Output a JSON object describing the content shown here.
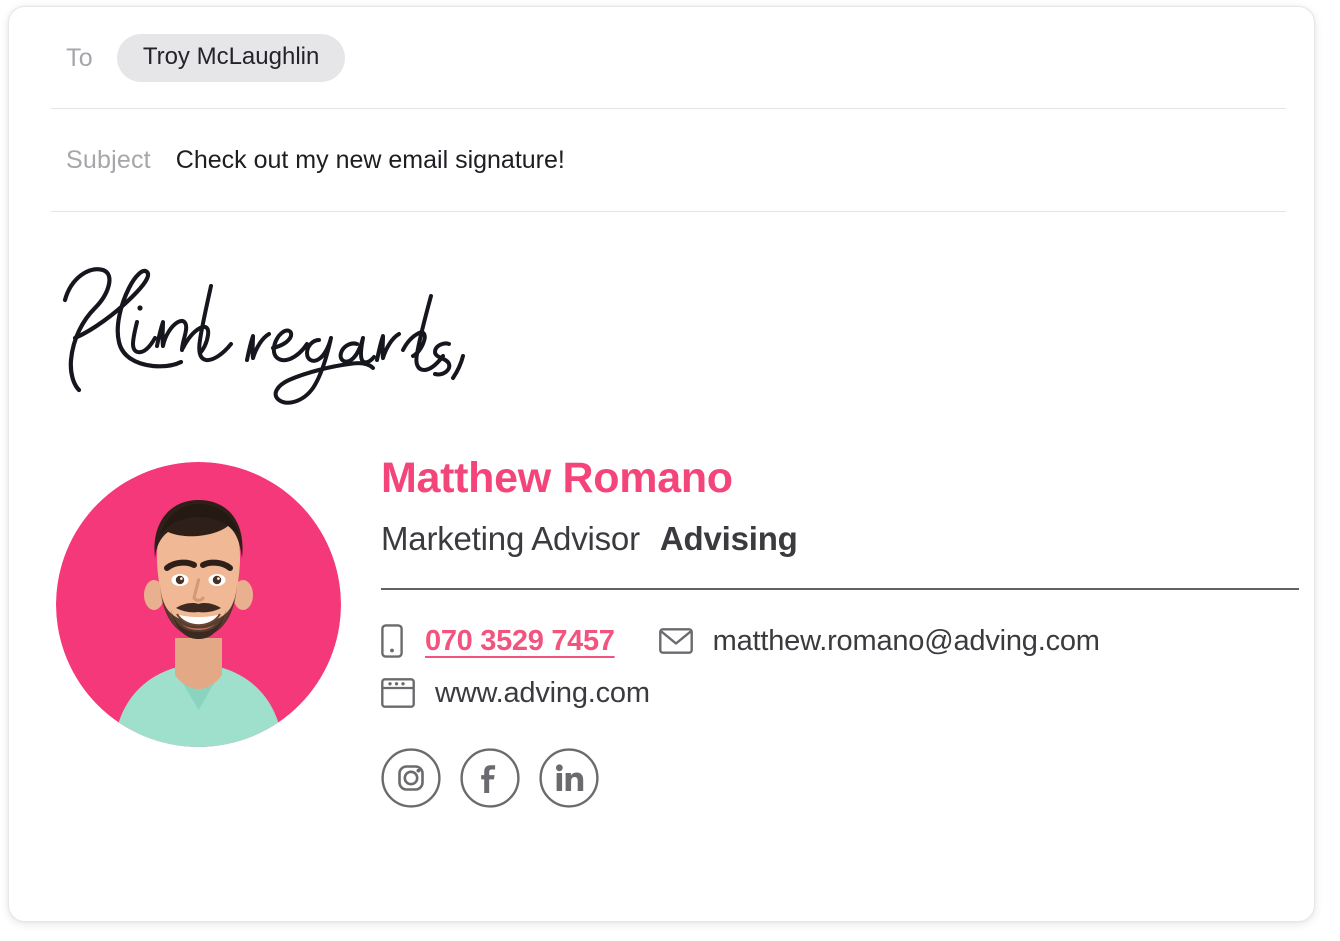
{
  "compose": {
    "to": {
      "label": "To",
      "recipient": "Troy McLaughlin"
    },
    "subject": {
      "label": "Subject",
      "value": "Check out my new email signature!"
    }
  },
  "body": {
    "signoff_text": "Kind regards,"
  },
  "signature": {
    "avatar_alt": "Matthew Romano headshot",
    "name": "Matthew Romano",
    "role": "Marketing Advisor",
    "company": "Advising",
    "contacts": [
      {
        "icon": "mobile-phone-icon",
        "label": "070 3529 7457",
        "type": "phone"
      },
      {
        "icon": "envelope-icon",
        "label": "matthew.romano@adving.com",
        "type": "email"
      },
      {
        "icon": "browser-window-icon",
        "label": "www.adving.com",
        "type": "website"
      }
    ],
    "socials": [
      {
        "icon": "instagram-icon",
        "label": "Instagram"
      },
      {
        "icon": "facebook-icon",
        "label": "Facebook"
      },
      {
        "icon": "linkedin-icon",
        "label": "LinkedIn"
      }
    ]
  },
  "colors": {
    "accent_pink": "#f4457a",
    "phone_pink": "#f2537f",
    "avatar_bg": "#f4387a",
    "text_dark": "#3b3b3f",
    "label_gray": "#a6a6ab",
    "divider_gray": "#5f6368",
    "icon_gray": "#6b6b6f",
    "chip_gray": "#e6e6e8"
  }
}
